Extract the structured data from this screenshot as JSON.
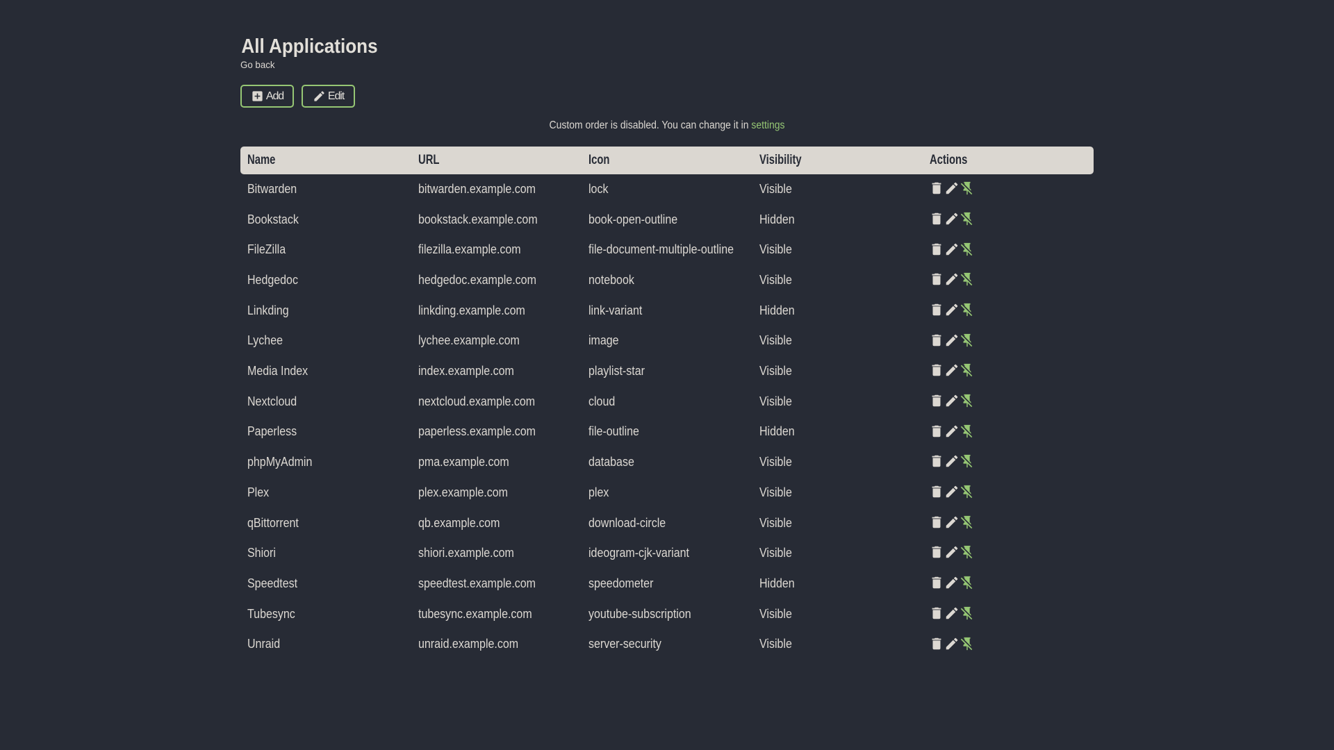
{
  "page": {
    "title": "All Applications",
    "back_label": "Go back",
    "toolbar": {
      "add_label": "Add",
      "add_icon": "plus-box-icon",
      "edit_label": "Edit",
      "edit_icon": "pencil-icon"
    },
    "notice": {
      "text_before_link": "Custom order is disabled. You can change it in ",
      "link_label": "settings"
    }
  },
  "table": {
    "columns": [
      "Name",
      "URL",
      "Icon",
      "Visibility",
      "Actions"
    ],
    "row_action_icons": [
      "delete-icon",
      "edit-icon",
      "unpin-icon"
    ],
    "rows": [
      {
        "name": "Bitwarden",
        "url": "bitwarden.example.com",
        "icon": "lock",
        "visibility": "Visible"
      },
      {
        "name": "Bookstack",
        "url": "bookstack.example.com",
        "icon": "book-open-outline",
        "visibility": "Hidden"
      },
      {
        "name": "FileZilla",
        "url": "filezilla.example.com",
        "icon": "file-document-multiple-outline",
        "visibility": "Visible"
      },
      {
        "name": "Hedgedoc",
        "url": "hedgedoc.example.com",
        "icon": "notebook",
        "visibility": "Visible"
      },
      {
        "name": "Linkding",
        "url": "linkding.example.com",
        "icon": "link-variant",
        "visibility": "Hidden"
      },
      {
        "name": "Lychee",
        "url": "lychee.example.com",
        "icon": "image",
        "visibility": "Visible"
      },
      {
        "name": "Media Index",
        "url": "index.example.com",
        "icon": "playlist-star",
        "visibility": "Visible"
      },
      {
        "name": "Nextcloud",
        "url": "nextcloud.example.com",
        "icon": "cloud",
        "visibility": "Visible"
      },
      {
        "name": "Paperless",
        "url": "paperless.example.com",
        "icon": "file-outline",
        "visibility": "Hidden"
      },
      {
        "name": "phpMyAdmin",
        "url": "pma.example.com",
        "icon": "database",
        "visibility": "Visible"
      },
      {
        "name": "Plex",
        "url": "plex.example.com",
        "icon": "plex",
        "visibility": "Visible"
      },
      {
        "name": "qBittorrent",
        "url": "qb.example.com",
        "icon": "download-circle",
        "visibility": "Visible"
      },
      {
        "name": "Shiori",
        "url": "shiori.example.com",
        "icon": "ideogram-cjk-variant",
        "visibility": "Visible"
      },
      {
        "name": "Speedtest",
        "url": "speedtest.example.com",
        "icon": "speedometer",
        "visibility": "Hidden"
      },
      {
        "name": "Tubesync",
        "url": "tubesync.example.com",
        "icon": "youtube-subscription",
        "visibility": "Visible"
      },
      {
        "name": "Unraid",
        "url": "unraid.example.com",
        "icon": "server-security",
        "visibility": "Visible"
      }
    ]
  },
  "colors": {
    "background": "#272b35",
    "primary": "#dcd8d2",
    "table_header_background": "#dbd7d1",
    "accent": "#96c774"
  }
}
